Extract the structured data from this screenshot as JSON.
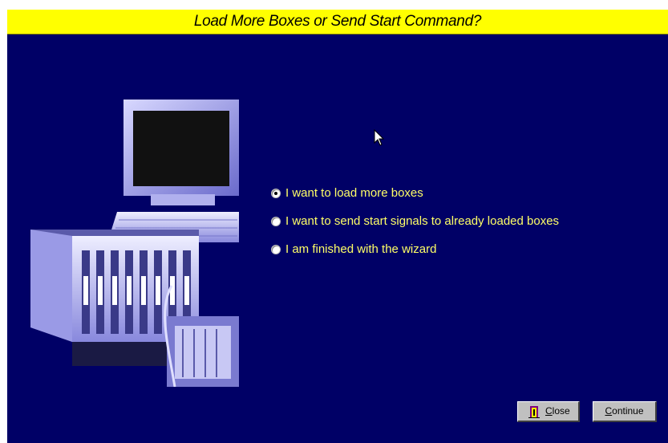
{
  "window": {
    "title": "Load More Boxes or Send Start Command?"
  },
  "options": [
    {
      "label": "I want to load more boxes",
      "selected": true
    },
    {
      "label": "I want to send start signals to already loaded boxes",
      "selected": false
    },
    {
      "label": "I am finished with the wizard",
      "selected": false
    }
  ],
  "buttons": {
    "close": {
      "underline": "C",
      "rest": "lose"
    },
    "continue": {
      "underline": "C",
      "rest": "ontinue"
    }
  },
  "colors": {
    "background": "#000066",
    "title_bar": "#ffff00",
    "option_text": "#ffff66",
    "button_face": "#c0c0c0"
  },
  "icons": {
    "close_button": "door-exit-icon",
    "pointer": "mouse-cursor-icon"
  }
}
